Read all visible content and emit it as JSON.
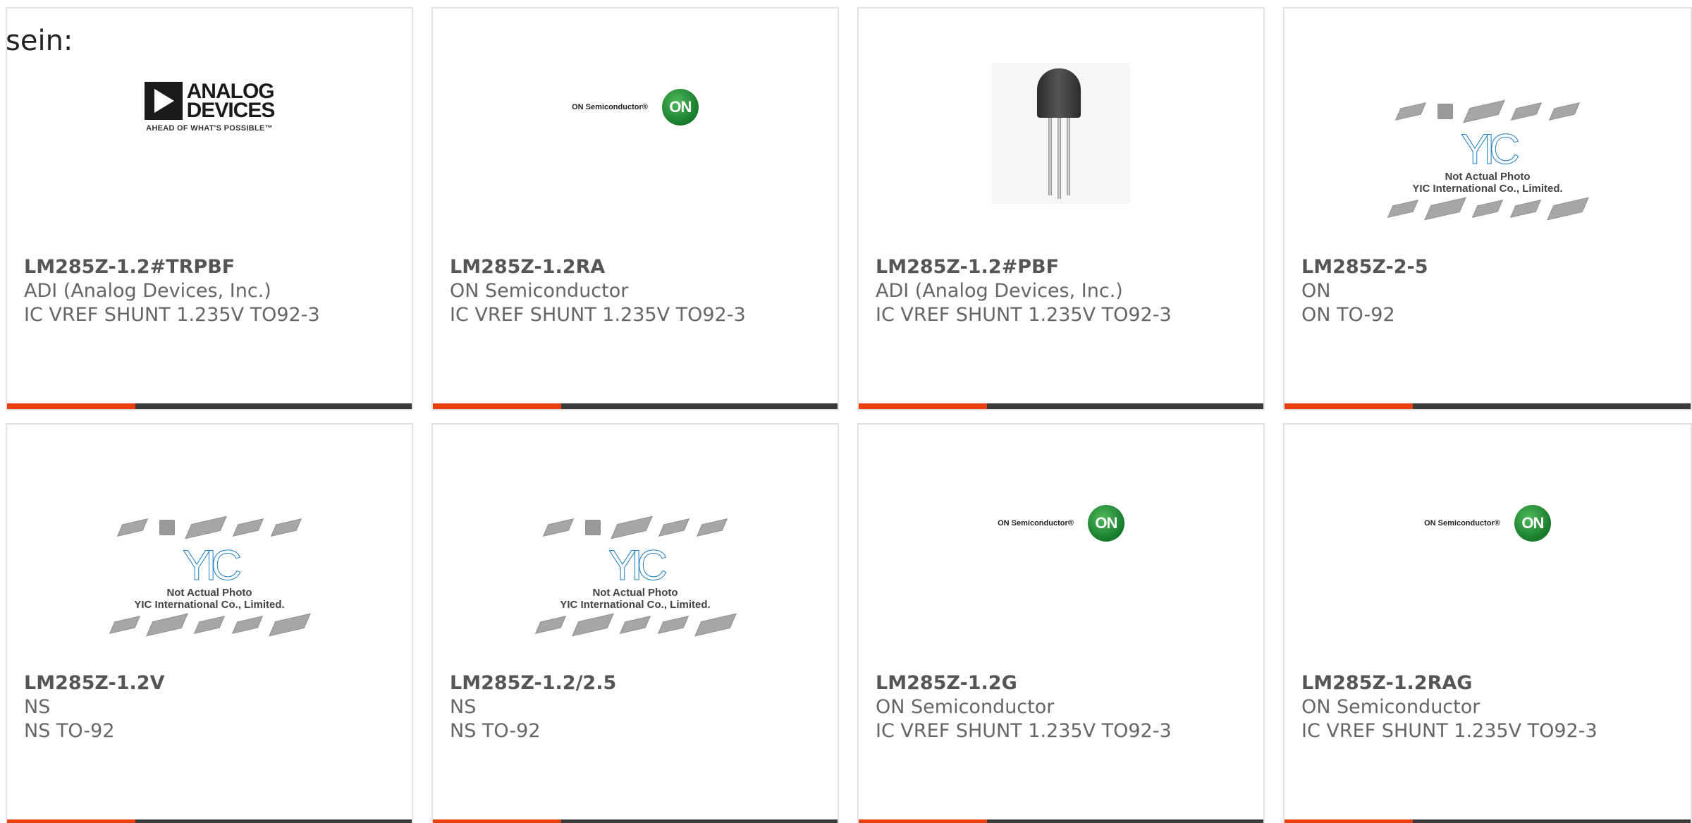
{
  "intro": "sein:",
  "cards": [
    {
      "part_no": "LM285Z-1.2#TRPBF",
      "manufacturer": "ADI (Analog Devices, Inc.)",
      "description": "IC VREF SHUNT 1.235V TO92-3",
      "image": "adi-logo",
      "logo": {
        "line1": "ANALOG",
        "line2": "DEVICES",
        "tagline": "AHEAD OF WHAT'S POSSIBLE™"
      }
    },
    {
      "part_no": "LM285Z-1.2RA",
      "manufacturer": "ON Semiconductor",
      "description": "IC VREF SHUNT 1.235V TO92-3",
      "image": "on-semi-logo",
      "logo": {
        "text": "ON Semiconductor®",
        "mark": "ON"
      }
    },
    {
      "part_no": "LM285Z-1.2#PBF",
      "manufacturer": "ADI (Analog Devices, Inc.)",
      "description": "IC VREF SHUNT 1.235V TO92-3",
      "image": "transistor-photo"
    },
    {
      "part_no": "LM285Z-2-5",
      "manufacturer": "ON",
      "description": "ON TO-92",
      "image": "yic-placeholder",
      "logo": {
        "mark": "YIC",
        "note1": "Not Actual Photo",
        "note2": "YIC International Co., Limited."
      }
    },
    {
      "part_no": "LM285Z-1.2V",
      "manufacturer": "NS",
      "description": "NS TO-92",
      "image": "yic-placeholder",
      "logo": {
        "mark": "YIC",
        "note1": "Not Actual Photo",
        "note2": "YIC International Co., Limited."
      }
    },
    {
      "part_no": "LM285Z-1.2/2.5",
      "manufacturer": "NS",
      "description": "NS TO-92",
      "image": "yic-placeholder",
      "logo": {
        "mark": "YIC",
        "note1": "Not Actual Photo",
        "note2": "YIC International Co., Limited."
      }
    },
    {
      "part_no": "LM285Z-1.2G",
      "manufacturer": "ON Semiconductor",
      "description": "IC VREF SHUNT 1.235V TO92-3",
      "image": "on-semi-logo",
      "logo": {
        "text": "ON Semiconductor®",
        "mark": "ON"
      }
    },
    {
      "part_no": "LM285Z-1.2RAG",
      "manufacturer": "ON Semiconductor",
      "description": "IC VREF SHUNT 1.235V TO92-3",
      "image": "on-semi-logo",
      "logo": {
        "text": "ON Semiconductor®",
        "mark": "ON"
      }
    }
  ],
  "colors": {
    "accent_bar": "#e8410f",
    "dark_bar": "#3a3a3a",
    "on_green": "#1f8a35",
    "yic_blue": "#1e7fc2"
  }
}
